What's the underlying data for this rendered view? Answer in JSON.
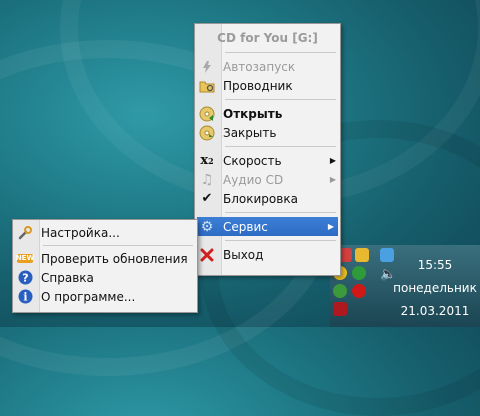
{
  "main_menu": {
    "title": "CD for You [G:]",
    "items": [
      {
        "label": "Автозапуск",
        "icon": "autorun-icon",
        "disabled": true
      },
      {
        "label": "Проводник",
        "icon": "explorer-folder-icon"
      },
      {
        "label": "Открыть",
        "icon": "cd-open-icon",
        "bold": true
      },
      {
        "label": "Закрыть",
        "icon": "cd-close-icon"
      },
      {
        "label": "Скорость",
        "icon": "speed-icon",
        "submenu": true
      },
      {
        "label": "Аудио CD",
        "icon": "audio-note-icon",
        "disabled": true,
        "submenu": true
      },
      {
        "label": "Блокировка",
        "icon": "checkmark-icon",
        "checked": true
      },
      {
        "label": "Сервис",
        "icon": "gear-icon",
        "submenu": true,
        "selected": true
      },
      {
        "label": "Выход",
        "icon": "exit-x-icon"
      }
    ]
  },
  "sub_menu": {
    "items": [
      {
        "label": "Настройка...",
        "icon": "wrench-icon"
      },
      {
        "label": "Проверить обновления",
        "icon": "new-badge-icon"
      },
      {
        "label": "Справка",
        "icon": "help-icon"
      },
      {
        "label": "О программе...",
        "icon": "info-icon"
      }
    ]
  },
  "taskbar": {
    "time": "15:55",
    "day": "понедельник",
    "date": "21.03.2011"
  },
  "colors": {
    "highlight": "#2d6bc4",
    "desktop": "#1f7a87"
  }
}
